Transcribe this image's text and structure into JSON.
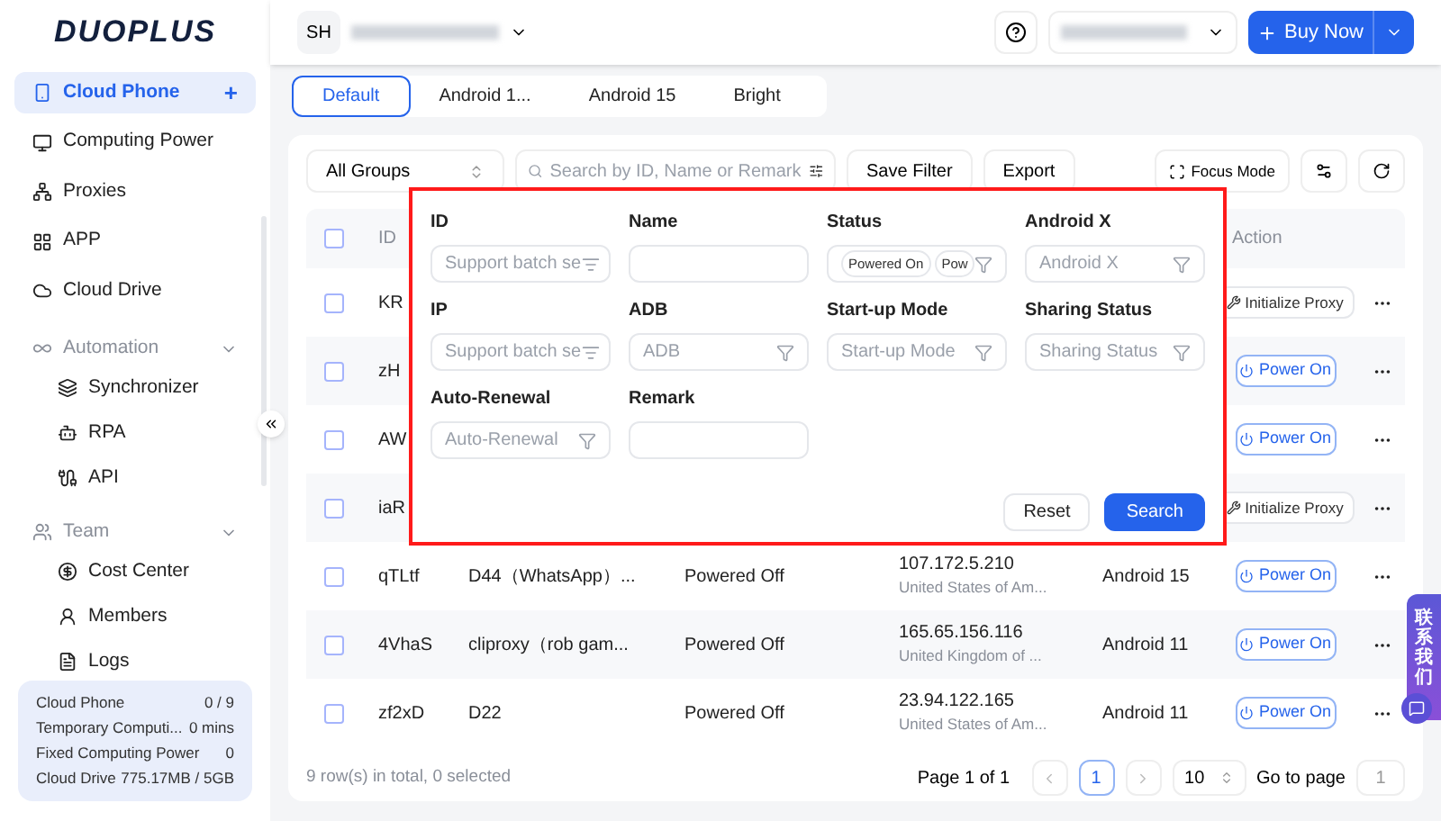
{
  "logo": "DUOPLUS",
  "sidebar": {
    "items": [
      {
        "kind": "item",
        "label": "Cloud Phone",
        "selected": true,
        "add": "+"
      },
      {
        "kind": "item",
        "label": "Computing Power",
        "selected": false
      },
      {
        "kind": "item",
        "label": "Proxies",
        "selected": false
      },
      {
        "kind": "item",
        "label": "APP",
        "selected": false
      },
      {
        "kind": "item",
        "label": "Cloud Drive",
        "selected": false
      },
      {
        "kind": "group",
        "label": "Automation",
        "expanded": true,
        "children": [
          {
            "label": "Synchronizer",
            "selected": false
          },
          {
            "label": "RPA",
            "selected": false
          },
          {
            "label": "API",
            "selected": false
          }
        ]
      },
      {
        "kind": "group",
        "label": "Team",
        "expanded": true,
        "children": [
          {
            "label": "Cost Center",
            "selected": false
          },
          {
            "label": "Members",
            "selected": false
          },
          {
            "label": "Logs",
            "selected": false
          }
        ]
      }
    ],
    "stats": [
      {
        "label": "Cloud Phone",
        "value": "0 / 9"
      },
      {
        "label": "Temporary Computi...",
        "value": "0 mins"
      },
      {
        "label": "Fixed Computing Power",
        "value": "0"
      },
      {
        "label": "Cloud Drive",
        "value": "775.17MB / 5GB"
      }
    ]
  },
  "header": {
    "avatar": "SH",
    "buy_button": "Buy Now"
  },
  "tabs": [
    {
      "label": "Default",
      "selected": true
    },
    {
      "label": "Android 1...",
      "selected": false
    },
    {
      "label": "Android 15",
      "selected": false
    },
    {
      "label": "Bright",
      "selected": false
    }
  ],
  "toolbar": {
    "group_select": "All Groups",
    "search": {
      "placeholder": "Search by ID, Name or Remark"
    },
    "buttons": [
      "Save Filter",
      "Export"
    ],
    "focus_mode": "Focus Mode"
  },
  "table": {
    "columns": [
      "ID",
      "Action"
    ],
    "header_checked": false,
    "rows": [
      {
        "id": "KR",
        "checked": false,
        "action": {
          "kind": "proxy",
          "label": "Initialize Proxy"
        }
      },
      {
        "id": "zH",
        "checked": false,
        "action": {
          "kind": "power",
          "label": "Power On"
        }
      },
      {
        "id": "AW",
        "checked": false,
        "action": {
          "kind": "power",
          "label": "Power On"
        }
      },
      {
        "id": "iaR",
        "checked": false,
        "action": {
          "kind": "proxy",
          "label": "Initialize Proxy"
        }
      },
      {
        "id": "qTLtf",
        "checked": false,
        "name": "D44（WhatsApp）...",
        "status": "Powered Off",
        "ip": "107.172.5.210",
        "location": "United States of Am...",
        "android": "Android 15",
        "action": {
          "kind": "power",
          "label": "Power On"
        }
      },
      {
        "id": "4VhaS",
        "checked": false,
        "name": "cliproxy（rob gam...",
        "status": "Powered Off",
        "ip": "165.65.156.116",
        "location": "United Kingdom of ...",
        "android": "Android 11",
        "action": {
          "kind": "power",
          "label": "Power On"
        }
      },
      {
        "id": "zf2xD",
        "checked": false,
        "name": "D22",
        "status": "Powered Off",
        "ip": "23.94.122.165",
        "location": "United States of Am...",
        "android": "Android 11",
        "action": {
          "kind": "power",
          "label": "Power On"
        }
      }
    ]
  },
  "footer": {
    "summary": "9 row(s) in total, 0 selected",
    "page_info": "Page 1 of 1",
    "pages": [
      {
        "label": "1",
        "selected": true
      }
    ],
    "page_size": "10",
    "goto_label": "Go to page",
    "goto_value": "1"
  },
  "filter_popup": {
    "fields": [
      {
        "label": "ID",
        "kind": "batch",
        "placeholder": "Support batch se"
      },
      {
        "label": "Name",
        "kind": "text"
      },
      {
        "label": "Status",
        "kind": "tags",
        "tags": [
          "Powered On",
          "Pow"
        ]
      },
      {
        "label": "Android X",
        "kind": "select",
        "placeholder": "Android X"
      },
      {
        "label": "IP",
        "kind": "batch",
        "placeholder": "Support batch se"
      },
      {
        "label": "ADB",
        "kind": "select",
        "placeholder": "ADB"
      },
      {
        "label": "Start-up Mode",
        "kind": "select",
        "placeholder": "Start-up Mode"
      },
      {
        "label": "Sharing Status",
        "kind": "select",
        "placeholder": "Sharing Status"
      },
      {
        "label": "Auto-Renewal",
        "kind": "select",
        "placeholder": "Auto-Renewal"
      },
      {
        "label": "Remark",
        "kind": "text"
      }
    ],
    "reset": "Reset",
    "search": "Search"
  },
  "contact_tab": "联系我们"
}
